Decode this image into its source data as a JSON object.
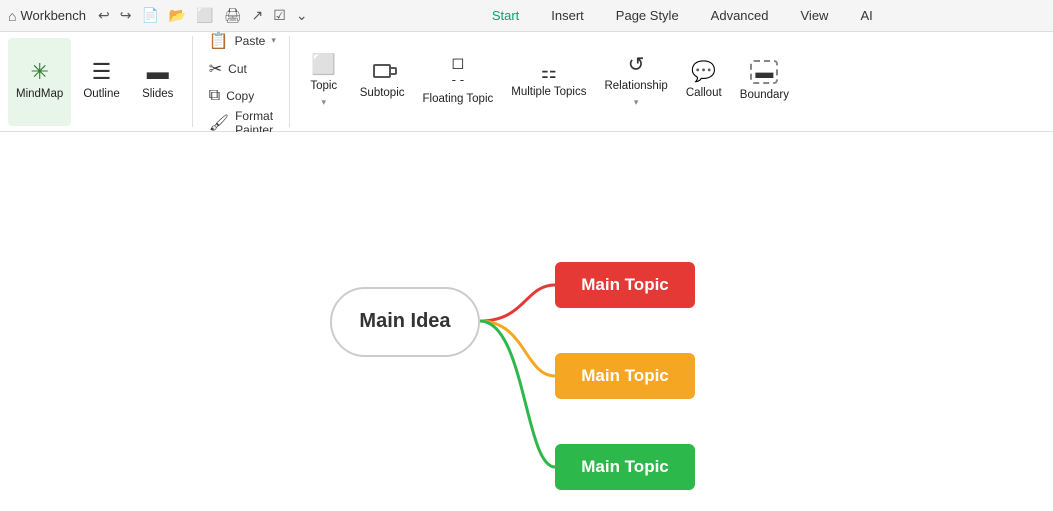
{
  "app": {
    "title": "Workbench",
    "home_icon": "⌂"
  },
  "toolbar_actions": [
    {
      "name": "undo",
      "icon": "↩",
      "label": "Undo"
    },
    {
      "name": "redo",
      "icon": "↪",
      "label": "Redo"
    },
    {
      "name": "new",
      "icon": "□",
      "label": "New"
    },
    {
      "name": "open",
      "icon": "📁",
      "label": "Open"
    },
    {
      "name": "mindmap-view",
      "icon": "⬜",
      "label": "View"
    },
    {
      "name": "print",
      "icon": "🖨",
      "label": "Print"
    },
    {
      "name": "export",
      "icon": "↗",
      "label": "Export"
    },
    {
      "name": "task",
      "icon": "✓",
      "label": "Task"
    },
    {
      "name": "more",
      "icon": "⌄",
      "label": "More"
    }
  ],
  "menu": {
    "items": [
      {
        "label": "Start",
        "active": true
      },
      {
        "label": "Insert",
        "active": false
      },
      {
        "label": "Page Style",
        "active": false
      },
      {
        "label": "Advanced",
        "active": false
      },
      {
        "label": "View",
        "active": false
      },
      {
        "label": "AI",
        "active": false
      }
    ]
  },
  "ribbon": {
    "groups": [
      {
        "name": "view-group",
        "buttons": [
          {
            "id": "mindmap",
            "icon": "⁂",
            "label": "MindMap",
            "active": true,
            "has_chevron": false
          },
          {
            "id": "outline",
            "icon": "≡",
            "label": "Outline",
            "active": false,
            "has_chevron": false
          },
          {
            "id": "slides",
            "icon": "▭",
            "label": "Slides",
            "active": false,
            "has_chevron": false
          }
        ]
      },
      {
        "name": "clipboard-group",
        "small": true,
        "buttons": [
          {
            "id": "paste",
            "icon": "📋",
            "label": "Paste",
            "has_chevron": true
          },
          {
            "id": "cut",
            "icon": "✂",
            "label": "Cut",
            "has_chevron": false
          },
          {
            "id": "copy",
            "icon": "⧉",
            "label": "Copy",
            "has_chevron": false
          },
          {
            "id": "format-painter",
            "icon": "🖌",
            "label": "Format Painter",
            "has_chevron": false
          }
        ]
      },
      {
        "name": "insert-group",
        "buttons": [
          {
            "id": "topic",
            "icon": "⬜",
            "label": "Topic",
            "active": false,
            "has_chevron": true
          },
          {
            "id": "subtopic",
            "icon": "⬛",
            "label": "Subtopic",
            "active": false,
            "has_chevron": false
          },
          {
            "id": "floating-topic",
            "icon": "◻",
            "label": "Floating Topic",
            "active": false,
            "has_chevron": false
          },
          {
            "id": "multiple-topics",
            "icon": "⬚",
            "label": "Multiple Topics",
            "active": false,
            "has_chevron": false
          },
          {
            "id": "relationship",
            "icon": "↺",
            "label": "Relationship",
            "active": false,
            "has_chevron": true
          },
          {
            "id": "callout",
            "icon": "◯",
            "label": "Callout",
            "active": false,
            "has_chevron": false
          },
          {
            "id": "boundary",
            "icon": "▭",
            "label": "Boundary",
            "active": false,
            "has_chevron": false
          }
        ]
      }
    ]
  },
  "mindmap": {
    "main_idea_label": "Main Idea",
    "topics": [
      {
        "label": "Main Topic",
        "color": "#e53935",
        "id": "topic-red"
      },
      {
        "label": "Main Topic",
        "color": "#f5a623",
        "id": "topic-orange"
      },
      {
        "label": "Main Topic",
        "color": "#2db84b",
        "id": "topic-green"
      }
    ]
  }
}
